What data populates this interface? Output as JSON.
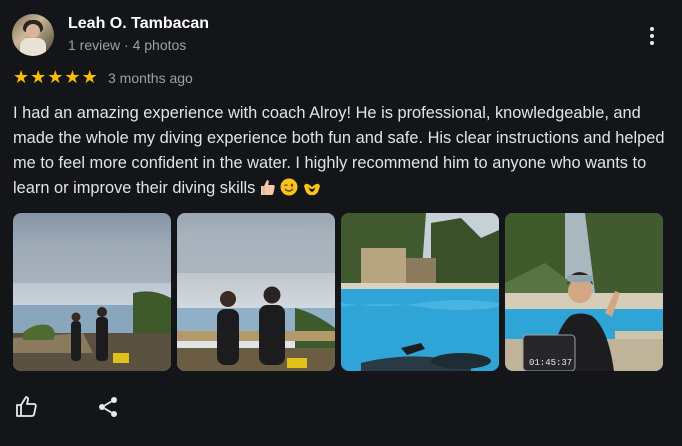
{
  "reviewer": {
    "name": "Leah O. Tambacan",
    "meta": "1 review · 4 photos"
  },
  "rating": {
    "stars": 5,
    "max": 5,
    "star_color": "#fbbc04",
    "time": "3 months ago"
  },
  "review": {
    "text": "I had an amazing experience with coach Alroy! He is professional, knowledgeable, and made the whole my diving experience both fun and safe. His clear instructions and helped me to feel more confident in the water. I highly recommend him to anyone who wants to learn or improve their diving skills",
    "emojis": [
      "thumbs-up-emoji",
      "winking-face-emoji",
      "heart-hands-emoji"
    ]
  },
  "photos": [
    {
      "name": "photo-divers-on-cliff"
    },
    {
      "name": "photo-divers-closeup"
    },
    {
      "name": "photo-pool"
    },
    {
      "name": "photo-diver-with-timer",
      "timer": "01:45:37"
    }
  ],
  "icons": {
    "like": "thumbs-up-icon",
    "share": "share-icon",
    "more": "more-vert-icon"
  },
  "colors": {
    "background": "#141519",
    "text": "#e8eaed",
    "secondary": "#9aa0a6"
  }
}
